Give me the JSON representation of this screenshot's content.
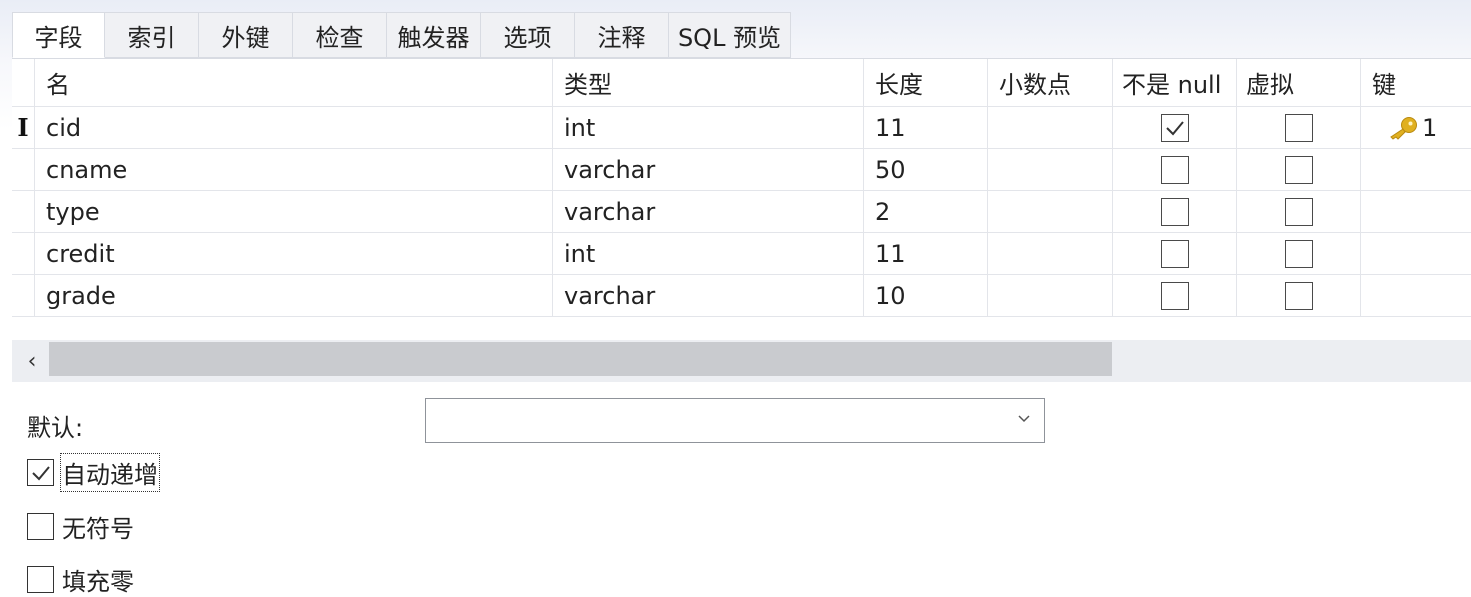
{
  "tabs": [
    {
      "label": "字段",
      "active": true
    },
    {
      "label": "索引"
    },
    {
      "label": "外键"
    },
    {
      "label": "检查"
    },
    {
      "label": "触发器"
    },
    {
      "label": "选项"
    },
    {
      "label": "注释"
    },
    {
      "label": "SQL 预览"
    }
  ],
  "grid": {
    "columns": [
      "名",
      "类型",
      "长度",
      "小数点",
      "不是 null",
      "虚拟",
      "键"
    ],
    "rows": [
      {
        "name": "cid",
        "type": "int",
        "length": "11",
        "decimals": "",
        "not_null": true,
        "virtual": false,
        "key": "1"
      },
      {
        "name": "cname",
        "type": "varchar",
        "length": "50",
        "decimals": "",
        "not_null": false,
        "virtual": false,
        "key": ""
      },
      {
        "name": "type",
        "type": "varchar",
        "length": "2",
        "decimals": "",
        "not_null": false,
        "virtual": false,
        "key": ""
      },
      {
        "name": "credit",
        "type": "int",
        "length": "11",
        "decimals": "",
        "not_null": false,
        "virtual": false,
        "key": ""
      },
      {
        "name": "grade",
        "type": "varchar",
        "length": "10",
        "decimals": "",
        "not_null": false,
        "virtual": false,
        "key": ""
      }
    ],
    "current_row_indicator": "I"
  },
  "scrollbar": {
    "left_arrow": "‹"
  },
  "props": {
    "default_label": "默认:",
    "default_value": "",
    "options": [
      {
        "label": "自动递增",
        "checked": true,
        "focused": true
      },
      {
        "label": "无符号",
        "checked": false
      },
      {
        "label": "填充零",
        "checked": false
      }
    ]
  },
  "colors": {
    "key_icon": "#e0b020",
    "accent_border": "#d8dbe2"
  },
  "icons": {
    "key": "key-icon",
    "check": "check-icon",
    "dropdown": "chevron-down-icon"
  }
}
